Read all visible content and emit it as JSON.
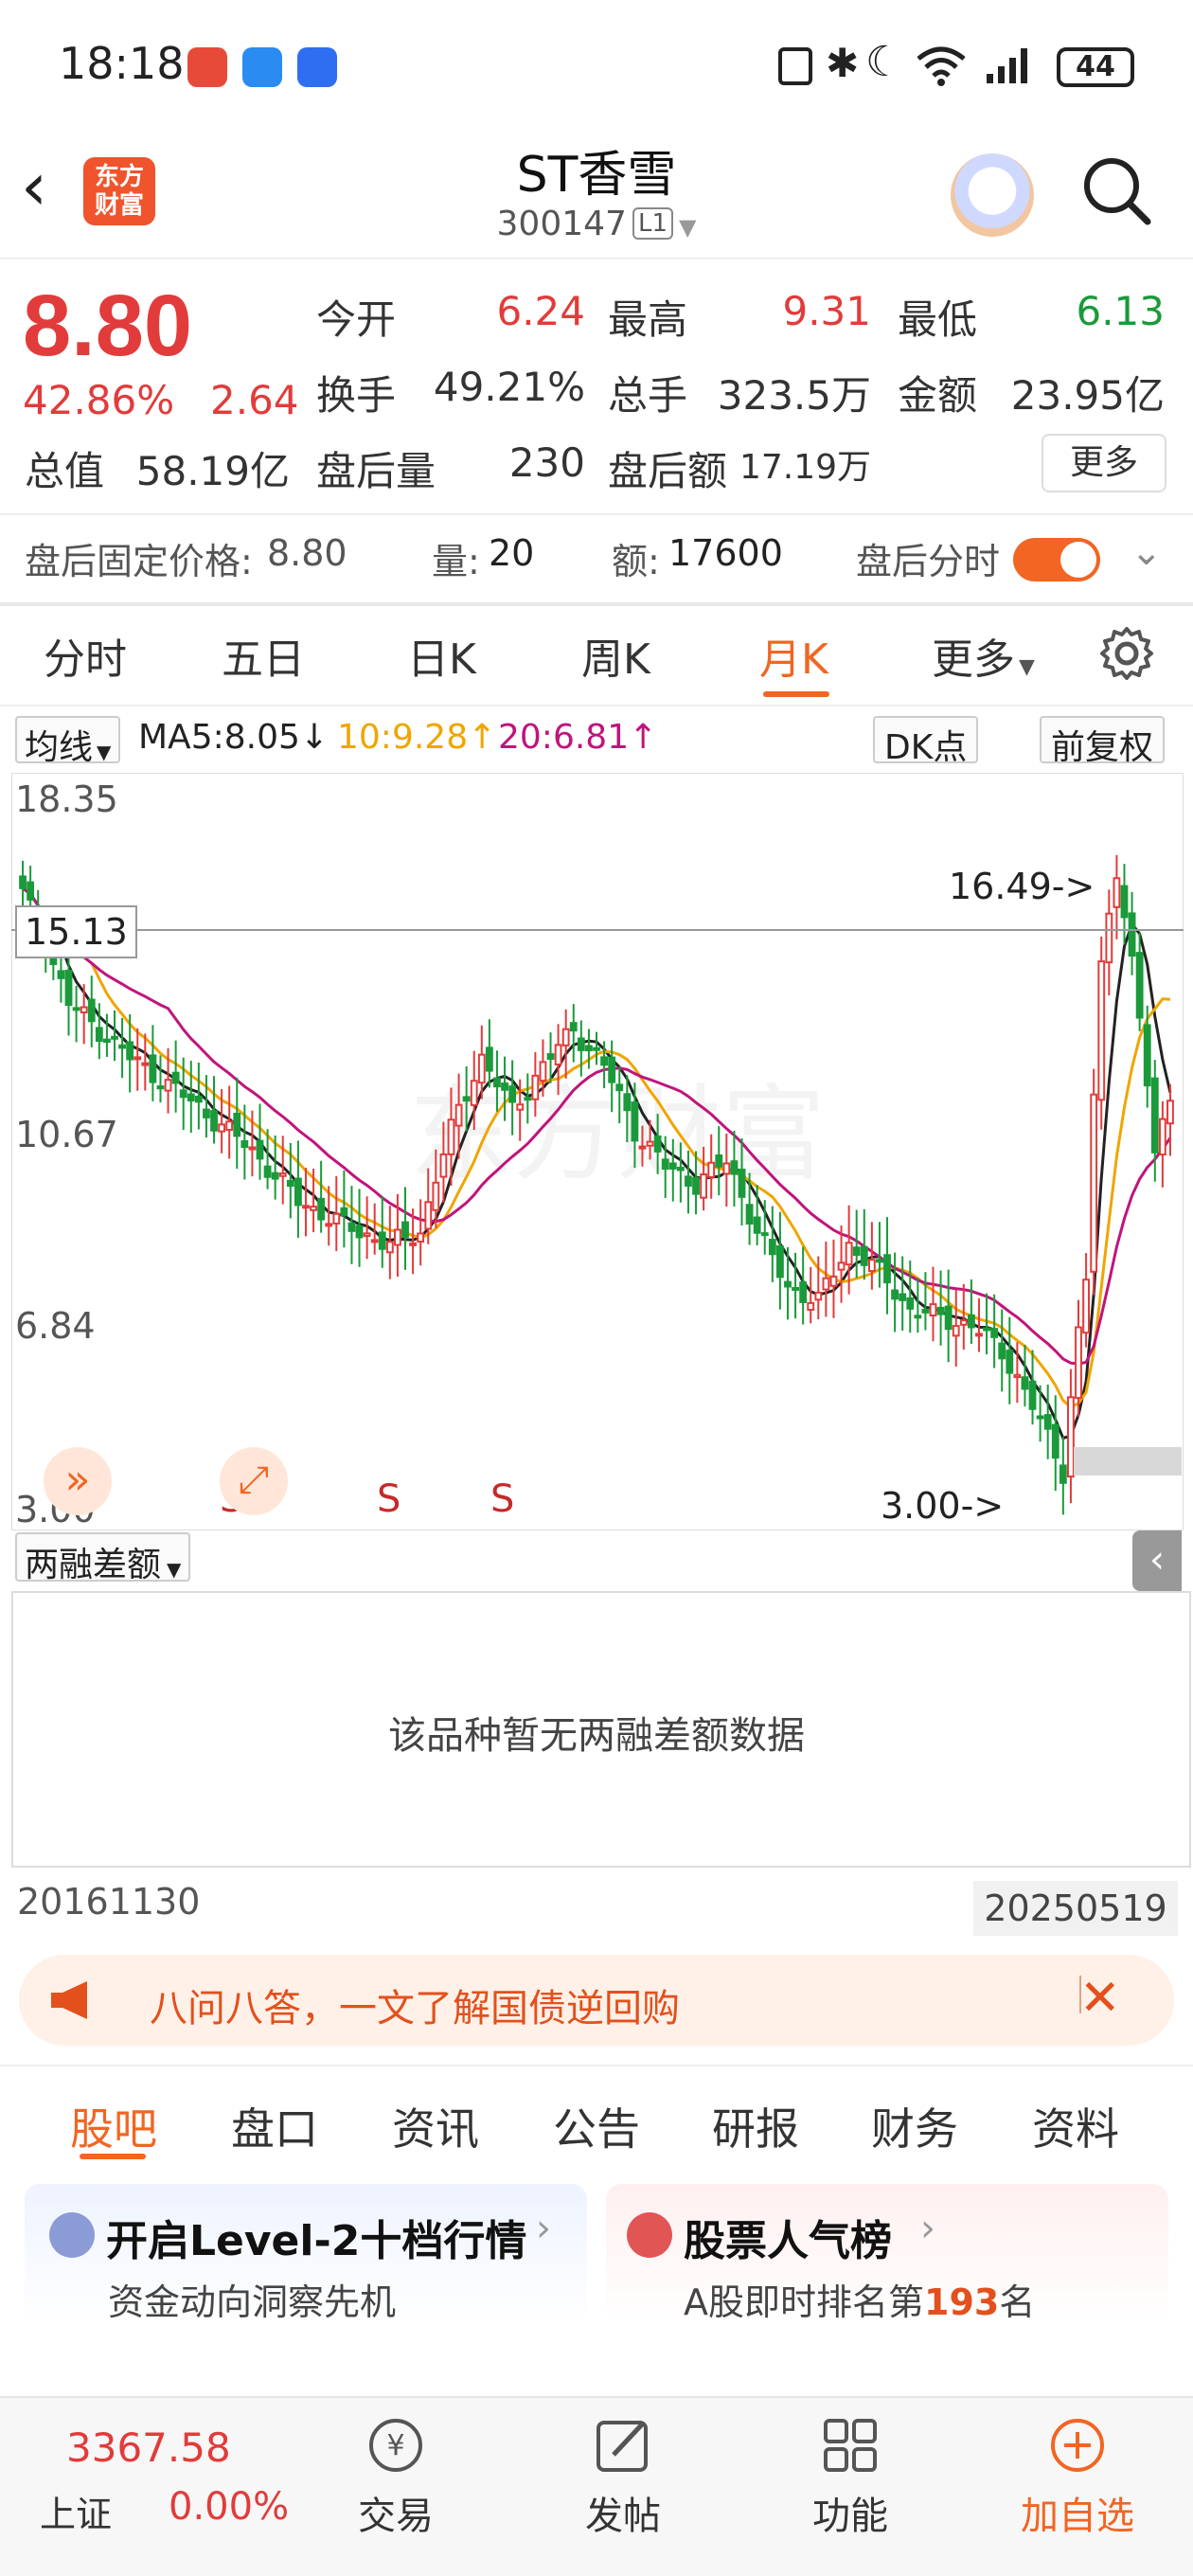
{
  "status_bar": {
    "time": "18:18",
    "battery": "44",
    "icons": [
      "nfc-icon",
      "bluetooth-icon",
      "moon-icon",
      "wifi-icon",
      "signal-icon",
      "battery-icon"
    ]
  },
  "header": {
    "logo_line1": "东方",
    "logo_line2": "财富",
    "title": "ST香雪",
    "code": "300147",
    "level": "L1"
  },
  "quote": {
    "price": "8.80",
    "change_pct": "42.86%",
    "change": "2.64",
    "stats": [
      {
        "label": "今开",
        "value": "6.24",
        "color": "red"
      },
      {
        "label": "最高",
        "value": "9.31",
        "color": "red"
      },
      {
        "label": "最低",
        "value": "6.13",
        "color": "green"
      },
      {
        "label": "换手",
        "value": "49.21%",
        "color": "gray"
      },
      {
        "label": "总手",
        "value": "323.5万",
        "color": "gray"
      },
      {
        "label": "金额",
        "value": "23.95亿",
        "color": "gray"
      },
      {
        "label": "总值",
        "value": "58.19亿",
        "color": "gray"
      },
      {
        "label": "盘后量",
        "value": "230",
        "color": "gray"
      },
      {
        "label": "盘后额",
        "value": "17.19万",
        "color": "gray"
      }
    ],
    "more": "更多"
  },
  "after_hours": {
    "price_label": "盘后固定价格:",
    "price_value": "8.80",
    "vol_label": "量:",
    "vol_value": "20",
    "amt_label": "额:",
    "amt_value": "17600",
    "toggle_label": "盘后分时"
  },
  "chart_tabs": [
    "分时",
    "五日",
    "日K",
    "周K",
    "月K",
    "更多"
  ],
  "active_tab": "月K",
  "ma": {
    "selector": "均线",
    "ma5": "MA5:8.05",
    "ma10": "10:9.28",
    "ma20": "20:6.81",
    "colors": {
      "ma5": "#222222",
      "ma10": "#f0a500",
      "ma20": "#c0147c"
    }
  },
  "chart_buttons": {
    "dk": "DK点",
    "adjust": "前复权"
  },
  "chart_data": {
    "type": "candlestick",
    "y_ticks": [
      "18.35",
      "10.67",
      "6.84",
      "3.00"
    ],
    "ylim": [
      3.0,
      18.35
    ],
    "crosshair_label": "15.13",
    "high_marker": "16.49->",
    "low_marker": "3.00->",
    "signals": [
      "S",
      "S",
      "S"
    ],
    "x_start": "20161130",
    "x_end": "20250519",
    "watermark": "东方财富",
    "colors": {
      "up": "#e23b3b",
      "down": "#1a9a3a"
    }
  },
  "sub_indicator": {
    "selector": "两融差额",
    "empty_text": "该品种暂无两融差额数据"
  },
  "banner": {
    "text": "八问八答，一文了解国债逆回购"
  },
  "section_tabs": [
    "股吧",
    "盘口",
    "资讯",
    "公告",
    "研报",
    "财务",
    "资料"
  ],
  "cards": [
    {
      "title": "开启Level-2十档行情",
      "subtitle": "资金动向洞察先机"
    },
    {
      "title": "股票人气榜",
      "subtitle_pre": "A股即时排名第",
      "rank": "193",
      "subtitle_post": "名"
    }
  ],
  "bottom_nav": {
    "index_value": "3367.58",
    "index_name": "上证",
    "index_pct": "0.00%",
    "items": [
      "交易",
      "发帖",
      "功能",
      "加自选"
    ]
  }
}
